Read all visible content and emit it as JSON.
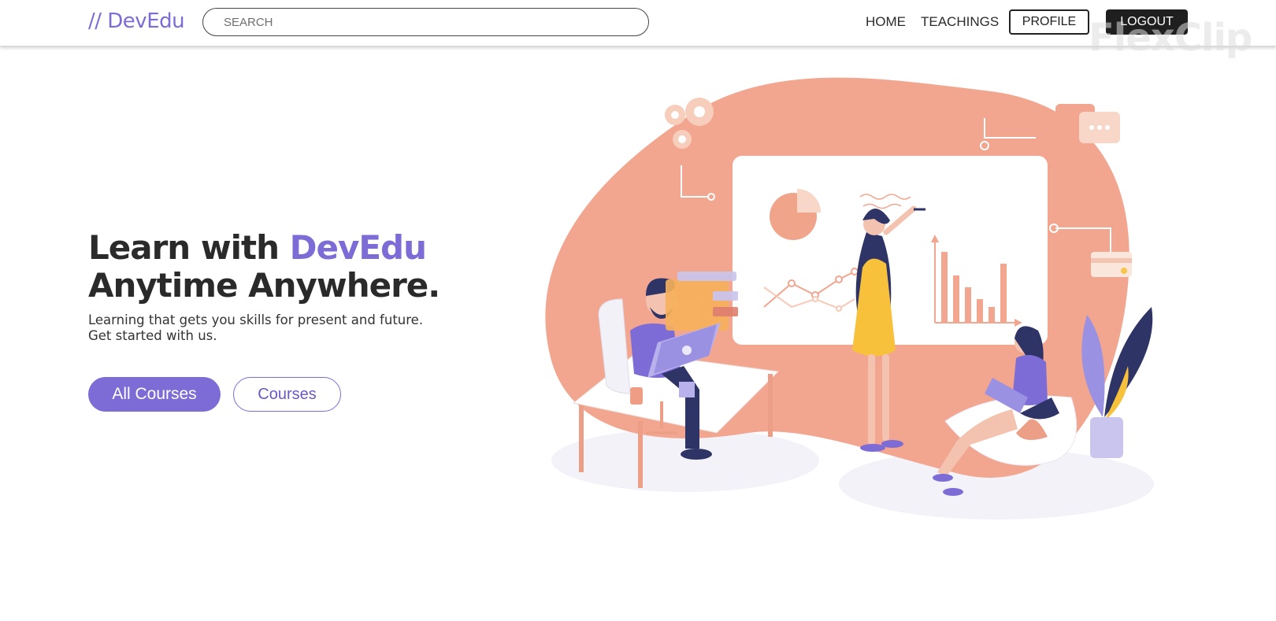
{
  "header": {
    "logo": "// DevEdu",
    "search_placeholder": "SEARCH",
    "nav": {
      "home": "HOME",
      "teachings": "TEACHINGS"
    },
    "profile_label": "PROFILE",
    "logout_label": "LOGOUT"
  },
  "watermark": "FlexClip",
  "hero": {
    "title_prefix": "Learn with ",
    "title_accent": "DevEdu",
    "title_line2": "Anytime Anywhere.",
    "subtitle_line1": "Learning that gets you skills for present and future.",
    "subtitle_line2": "Get started with us.",
    "all_courses_label": "All Courses",
    "courses_label": "Courses"
  },
  "colors": {
    "brand": "#7d6bd6",
    "blob": "#f2a58f",
    "dark_button": "#1f1f1f",
    "heading": "#2a2a2a"
  }
}
